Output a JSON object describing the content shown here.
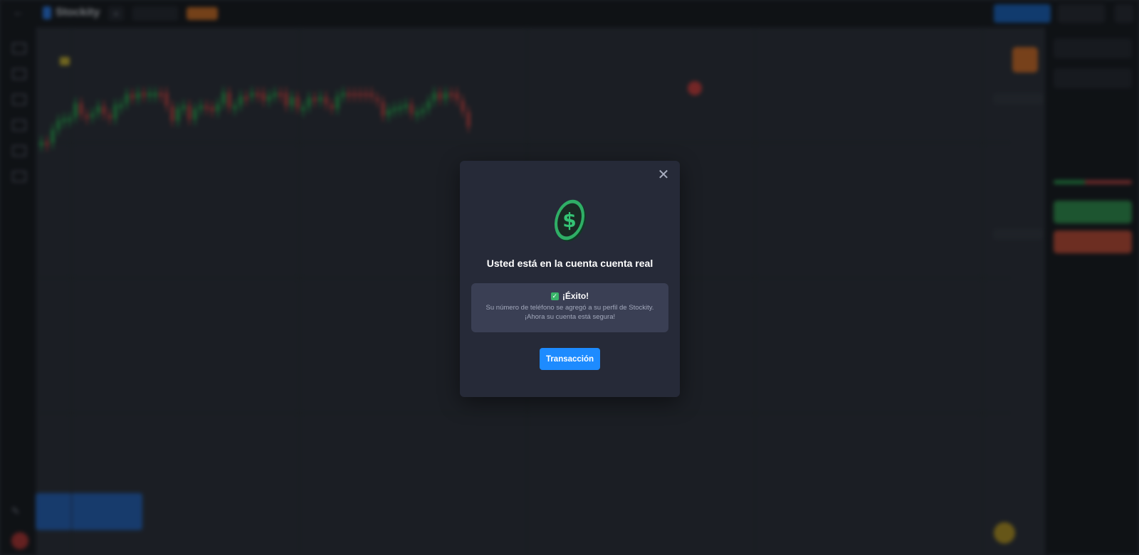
{
  "topbar": {
    "back_icon": "arrow-left-icon",
    "logo_text": "Stockity",
    "add_tab_label": "+",
    "asset_tab": "",
    "badge": "",
    "account_label": "",
    "deposit_label": "",
    "withdraw_label": ""
  },
  "sidebar": {
    "icons": [
      "chart-icon",
      "trades-icon",
      "stats-icon",
      "signals-icon",
      "news-icon",
      "settings-icon"
    ]
  },
  "right_panel": {
    "amount": "",
    "up_color": "#36a158",
    "down_color": "#d3553f"
  },
  "colors": {
    "accent": "#1d8bff",
    "success": "#3ab56a",
    "candle_up": "#2fa957",
    "candle_down": "#c44a4a",
    "modal_bg": "#262a38"
  },
  "modal": {
    "close_label": "✕",
    "coin_icon": "dollar-coin-icon",
    "title": "Usted está en la cuenta cuenta real",
    "success": {
      "icon": "check-icon",
      "heading": "¡Éxito!",
      "line1": "Su número de teléfono se agregó a su perfil de Stockity.",
      "line2": "¡Ahora su cuenta está segura!"
    },
    "button_label": "Transacción"
  }
}
